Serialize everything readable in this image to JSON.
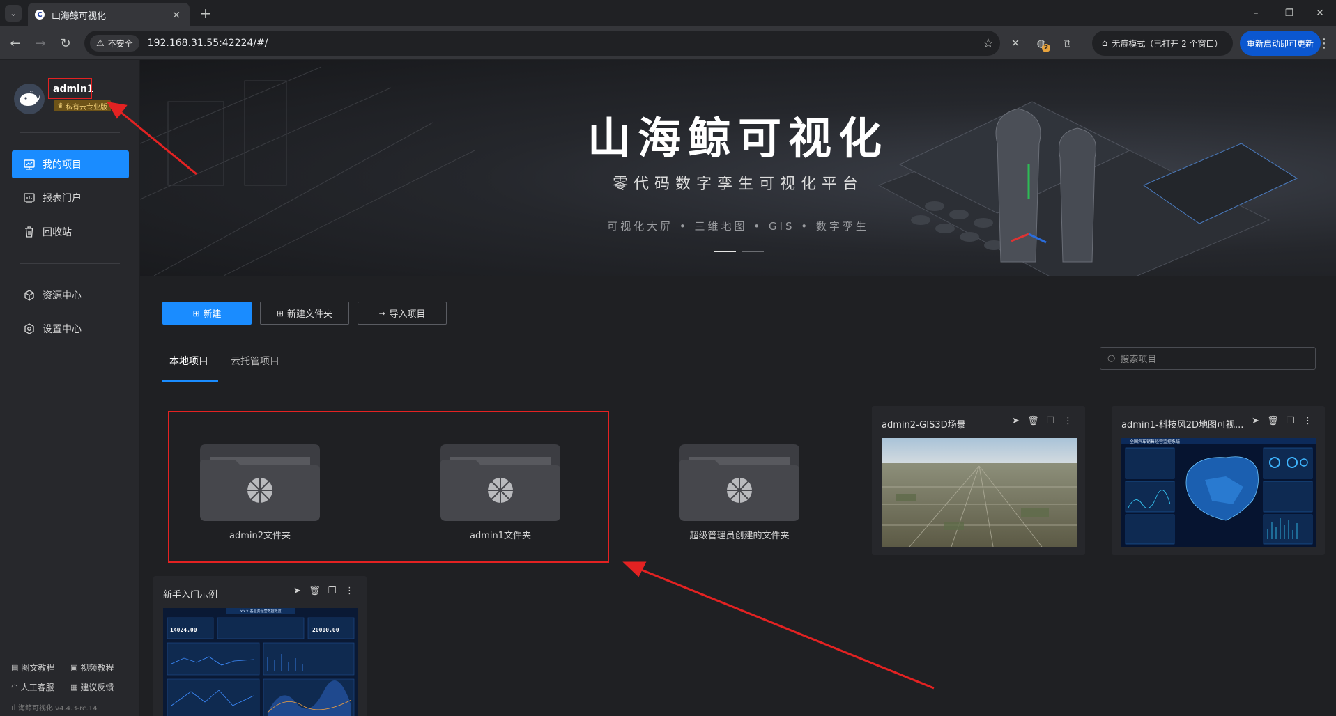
{
  "browser": {
    "tab_title": "山海鲸可视化",
    "tab_favicon": "C",
    "url": "192.168.31.55:42224/#/",
    "insecure_label": "不安全",
    "incognito_label": "无痕模式（已打开 2 个窗口）",
    "update_label": "重新启动即可更新",
    "extension_badge": "2"
  },
  "sidebar": {
    "username": "admin1",
    "edition": "私有云专业版",
    "nav": [
      {
        "label": "我的项目",
        "active": true
      },
      {
        "label": "报表门户"
      },
      {
        "label": "回收站"
      },
      {
        "label": "资源中心"
      },
      {
        "label": "设置中心"
      }
    ],
    "footer": {
      "text_tutorial": "图文教程",
      "video_tutorial": "视频教程",
      "support": "人工客服",
      "feedback": "建议反馈",
      "version": "山海鲸可视化 v4.4.3-rc.14"
    }
  },
  "banner": {
    "title": "山海鲸可视化",
    "subtitle": "零代码数字孪生可视化平台",
    "tags": "可视化大屏 • 三维地图 • GIS • 数字孪生"
  },
  "actions": {
    "new": "新建",
    "new_folder": "新建文件夹",
    "import": "导入项目"
  },
  "tabs": {
    "local": "本地项目",
    "cloud": "云托管项目"
  },
  "search": {
    "placeholder": "搜索项目"
  },
  "folders": [
    {
      "name": "admin2文件夹"
    },
    {
      "name": "admin1文件夹"
    },
    {
      "name": "超级管理员创建的文件夹"
    }
  ],
  "projects": [
    {
      "title": "admin2-GIS3D场景"
    },
    {
      "title": "admin1-科技风2D地图可视...",
      "thumb_caption": "全国汽车销售经营监控系统"
    },
    {
      "title": "新手入门示例",
      "thumb_caption": "××× 各业务经营数据概览",
      "thumb_left_value": "14024.00",
      "thumb_right_value": "20000.00"
    }
  ],
  "colors": {
    "accent": "#1a8cff",
    "annotation": "#e32222",
    "edition_badge": "#6d5318"
  }
}
